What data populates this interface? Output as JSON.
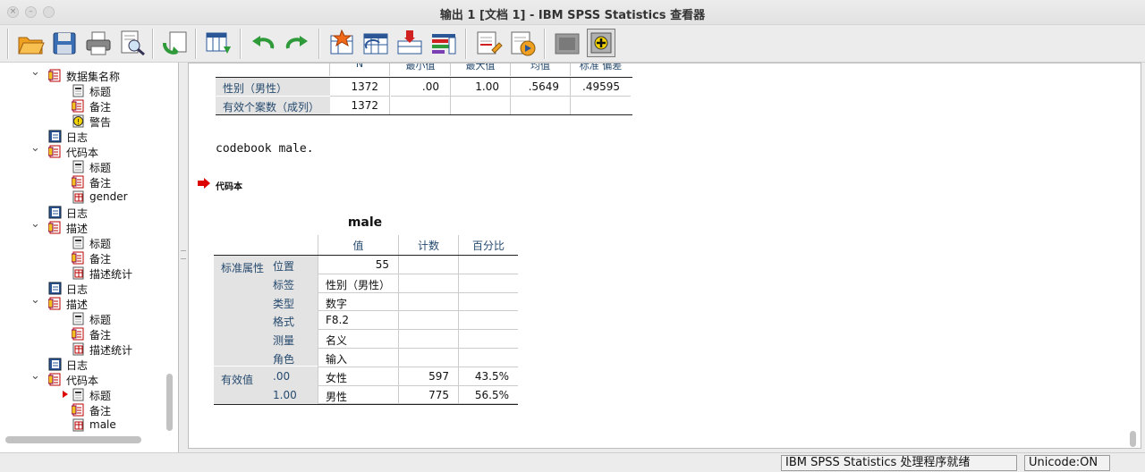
{
  "window": {
    "title": "输出 1 [文档 1] - IBM SPSS Statistics 查看器"
  },
  "toolbar": {
    "buttons": [
      "open-icon",
      "save-icon",
      "print-icon",
      "print-preview-icon",
      "export-icon",
      "grid-icon",
      "undo-icon",
      "redo-icon",
      "goto-data-icon",
      "goto-case-icon",
      "goto-variable-icon",
      "variables-icon",
      "insert-output-icon",
      "run-icon",
      "designate-window-icon",
      "add-icon"
    ]
  },
  "tree": {
    "items": [
      {
        "label": "数据集名称",
        "level": 1,
        "icon": "notes-icon",
        "expanded": true
      },
      {
        "label": "标题",
        "level": 2,
        "icon": "title-icon"
      },
      {
        "label": "备注",
        "level": 2,
        "icon": "notes-icon"
      },
      {
        "label": "警告",
        "level": 2,
        "icon": "warning-icon"
      },
      {
        "label": "日志",
        "level": 1,
        "icon": "log-icon"
      },
      {
        "label": "代码本",
        "level": 1,
        "icon": "notes-icon",
        "expanded": true
      },
      {
        "label": "标题",
        "level": 2,
        "icon": "title-icon"
      },
      {
        "label": "备注",
        "level": 2,
        "icon": "notes-icon"
      },
      {
        "label": "gender",
        "level": 2,
        "icon": "table-icon"
      },
      {
        "label": "日志",
        "level": 1,
        "icon": "log-icon"
      },
      {
        "label": "描述",
        "level": 1,
        "icon": "notes-icon",
        "expanded": true
      },
      {
        "label": "标题",
        "level": 2,
        "icon": "title-icon"
      },
      {
        "label": "备注",
        "level": 2,
        "icon": "notes-icon"
      },
      {
        "label": "描述统计",
        "level": 2,
        "icon": "table-icon"
      },
      {
        "label": "日志",
        "level": 1,
        "icon": "log-icon"
      },
      {
        "label": "描述",
        "level": 1,
        "icon": "notes-icon",
        "expanded": true
      },
      {
        "label": "标题",
        "level": 2,
        "icon": "title-icon"
      },
      {
        "label": "备注",
        "level": 2,
        "icon": "notes-icon"
      },
      {
        "label": "描述统计",
        "level": 2,
        "icon": "table-icon"
      },
      {
        "label": "日志",
        "level": 1,
        "icon": "log-icon"
      },
      {
        "label": "代码本",
        "level": 1,
        "icon": "notes-icon",
        "expanded": true
      },
      {
        "label": "标题",
        "level": 2,
        "icon": "title-icon",
        "current": true
      },
      {
        "label": "备注",
        "level": 2,
        "icon": "notes-icon"
      },
      {
        "label": "male",
        "level": 2,
        "icon": "table-icon"
      }
    ]
  },
  "descriptives": {
    "headers": [
      "N",
      "最小值",
      "最大值",
      "均值",
      "标准 偏差"
    ],
    "rows": [
      {
        "label": "性别（男性）",
        "cells": [
          "1372",
          ".00",
          "1.00",
          ".5649",
          ".49595"
        ]
      },
      {
        "label": "有效个案数（成列）",
        "cells": [
          "1372",
          "",
          "",
          "",
          ""
        ]
      }
    ]
  },
  "syntax": {
    "command": "codebook male."
  },
  "section": {
    "title": "代码本"
  },
  "codebook": {
    "title": "male",
    "headers": [
      "值",
      "计数",
      "百分比"
    ],
    "group1": "标准属性",
    "group2": "有效值",
    "attr_rows": [
      {
        "label": "位置",
        "value": "55"
      },
      {
        "label": "标签",
        "value": "性别（男性）"
      },
      {
        "label": "类型",
        "value": "数字"
      },
      {
        "label": "格式",
        "value": "F8.2"
      },
      {
        "label": "测量",
        "value": "名义"
      },
      {
        "label": "角色",
        "value": "输入"
      }
    ],
    "value_rows": [
      {
        "label": ".00",
        "value": "女性",
        "count": "597",
        "percent": "43.5%"
      },
      {
        "label": "1.00",
        "value": "男性",
        "count": "775",
        "percent": "56.5%"
      }
    ]
  },
  "status": {
    "processor": "IBM SPSS Statistics 处理程序就绪",
    "unicode": "Unicode:ON"
  },
  "colors": {
    "header_text": "#264a6e",
    "row_label_bg": "#e3e3e3",
    "accent_red": "#dd0000"
  }
}
